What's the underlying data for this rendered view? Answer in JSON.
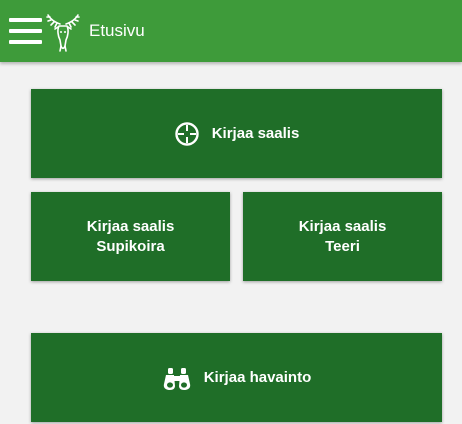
{
  "header": {
    "title": "Etusivu",
    "menu_icon": "hamburger-menu-icon",
    "logo": "moose-logo",
    "bar_color": "#3e9b3a"
  },
  "tiles": {
    "color": "#1f6e28",
    "record_catch": {
      "label": "Kirjaa saalis",
      "icon": "crosshair-icon"
    },
    "record_raccoon_dog": {
      "line1": "Kirjaa saalis",
      "line2": "Supikoira"
    },
    "record_black_grouse": {
      "line1": "Kirjaa saalis",
      "line2": "Teeri"
    },
    "record_observation": {
      "label": "Kirjaa havainto",
      "icon": "binoculars-icon"
    }
  }
}
